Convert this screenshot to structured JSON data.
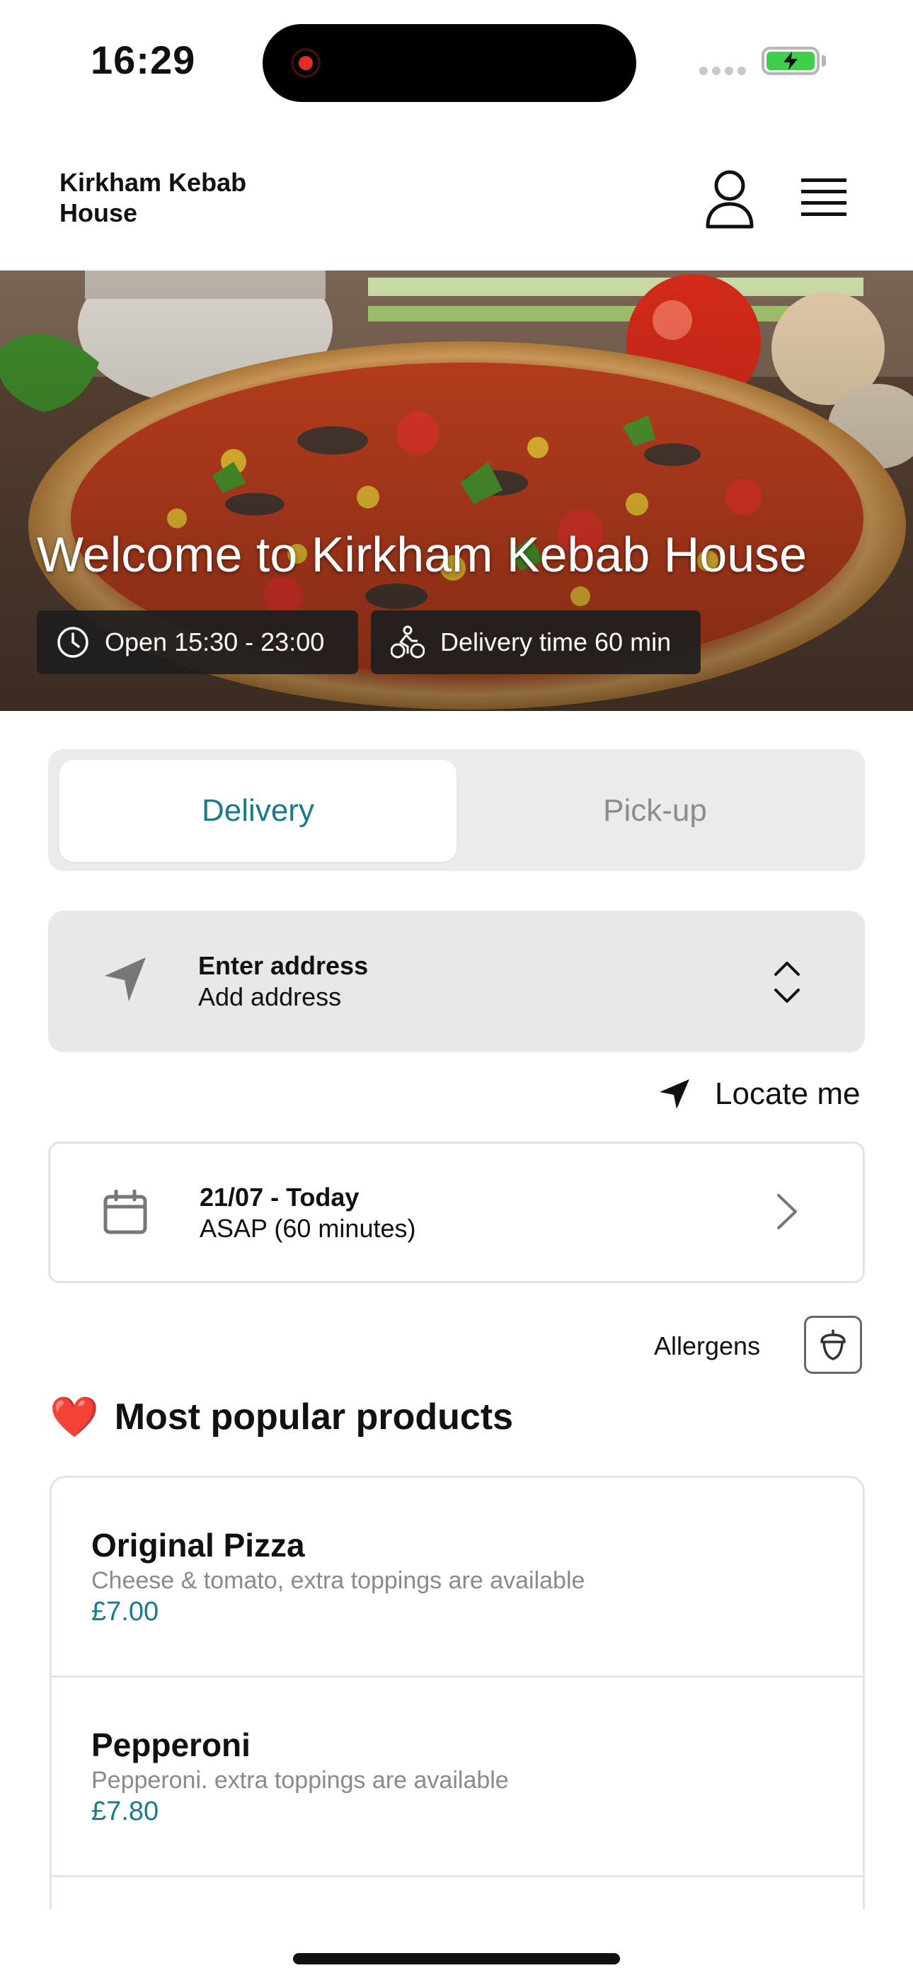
{
  "status_bar": {
    "time": "16:29"
  },
  "header": {
    "brand": "Kirkham Kebab House"
  },
  "hero": {
    "title": "Welcome to Kirkham Kebab House",
    "open_hours": "Open 15:30 - 23:00",
    "delivery_time": "Delivery time 60 min"
  },
  "order_mode": {
    "delivery_label": "Delivery",
    "pickup_label": "Pick-up",
    "selected": "Delivery"
  },
  "address": {
    "title": "Enter address",
    "subtitle": "Add address"
  },
  "locate": {
    "label": "Locate me"
  },
  "schedule": {
    "date": "21/07 - Today",
    "time": "ASAP (60 minutes)"
  },
  "allergens": {
    "label": "Allergens"
  },
  "popular": {
    "heading": "Most popular products",
    "emoji": "❤️",
    "products": [
      {
        "name": "Original Pizza",
        "description": "Cheese & tomato, extra toppings are available",
        "price": "£7.00"
      },
      {
        "name": "Pepperoni",
        "description": "Pepperoni. extra toppings are available",
        "price": "£7.80"
      }
    ]
  },
  "colors": {
    "accent": "#1a7a8c",
    "battery": "#3fcf4d",
    "recording": "#e32b2b"
  }
}
